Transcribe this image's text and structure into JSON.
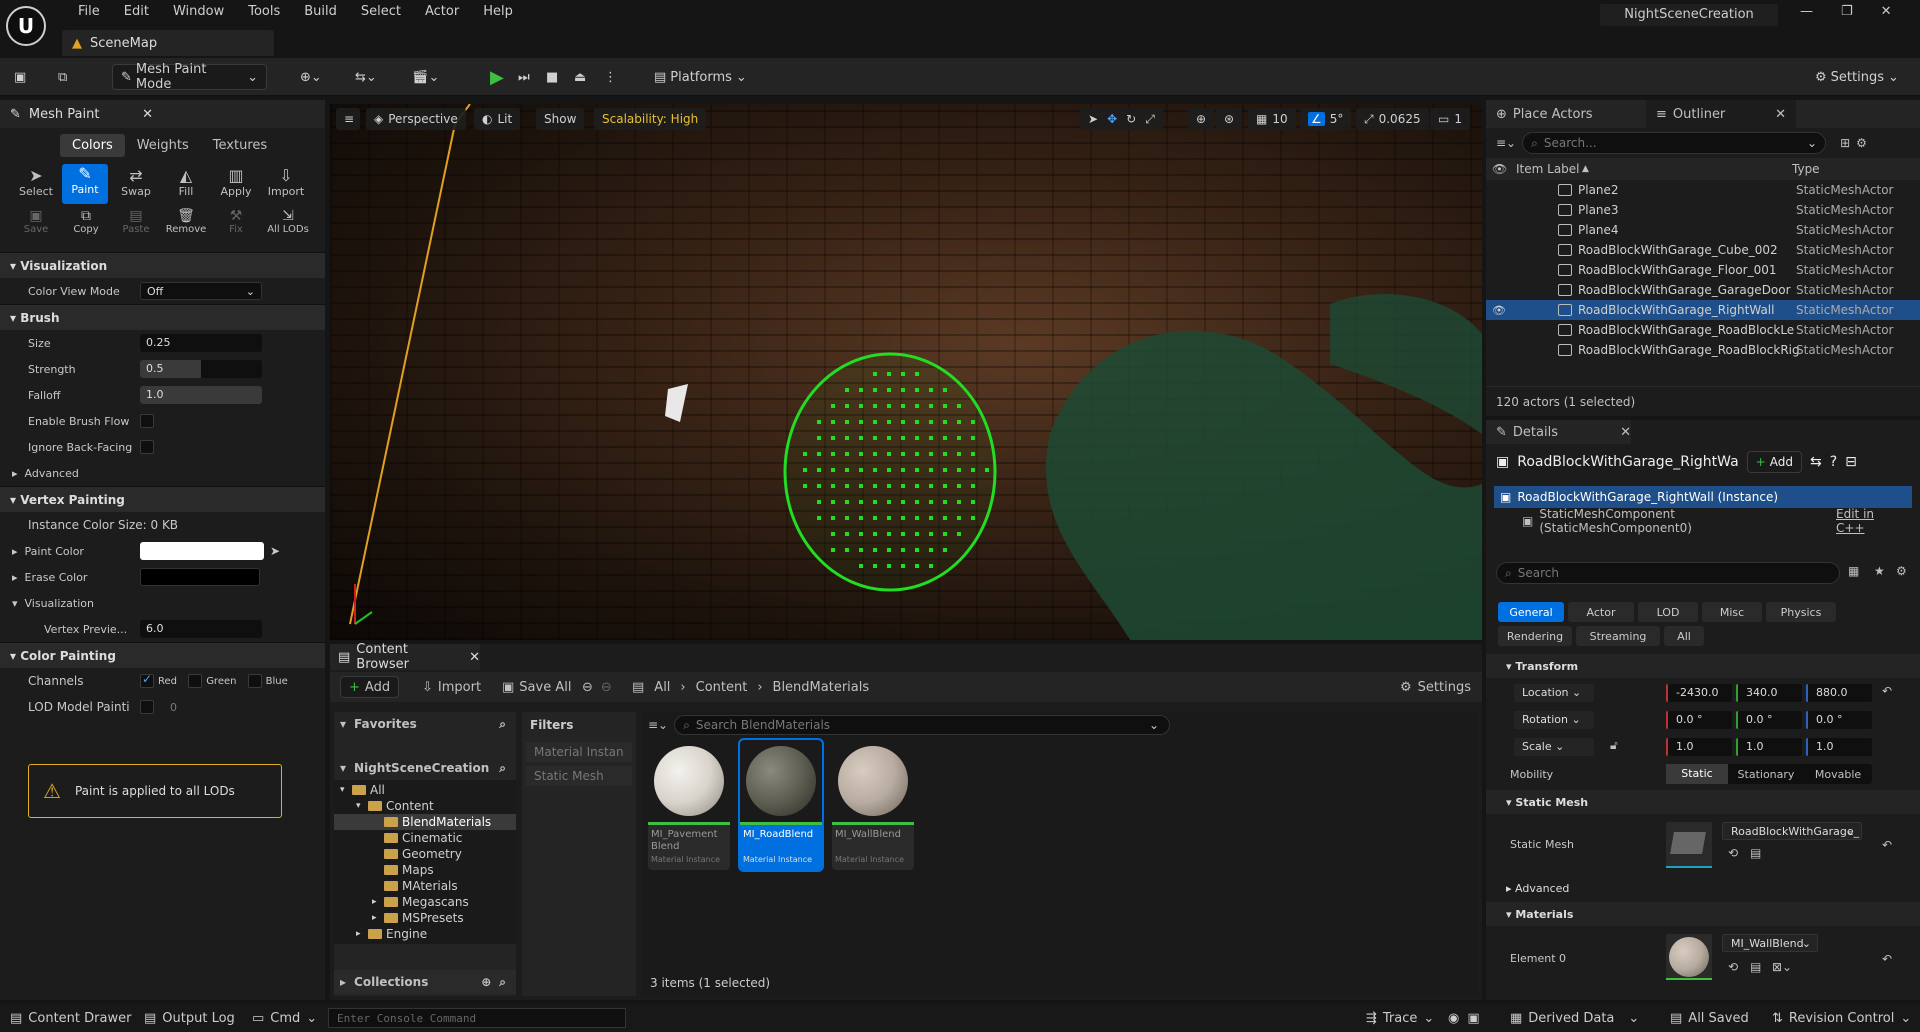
{
  "app": {
    "project_name": "NightSceneCreation",
    "map_tab": "SceneMap",
    "logo_glyph": "U"
  },
  "menu": [
    "File",
    "Edit",
    "Window",
    "Tools",
    "Build",
    "Select",
    "Actor",
    "Help"
  ],
  "toolbar": {
    "mode": "Mesh Paint Mode",
    "platforms": "Platforms",
    "settings": "Settings"
  },
  "mesh_paint": {
    "tab_title": "Mesh Paint",
    "subtabs": [
      "Colors",
      "Weights",
      "Textures"
    ],
    "tools_row1": [
      "Select",
      "Paint",
      "Swap",
      "Fill",
      "Apply",
      "Import"
    ],
    "tools_row2": [
      "Save",
      "Copy",
      "Paste",
      "Remove",
      "Fix",
      "All LODs"
    ],
    "visualization": {
      "header": "Visualization",
      "color_view_mode_label": "Color View Mode",
      "color_view_mode_value": "Off"
    },
    "brush": {
      "header": "Brush",
      "size_label": "Size",
      "size_value": "0.25",
      "strength_label": "Strength",
      "strength_value": "0.5",
      "strength_fill": 0.5,
      "falloff_label": "Falloff",
      "falloff_value": "1.0",
      "enable_brush_flow": "Enable Brush Flow",
      "ignore_back_facing": "Ignore Back-Facing"
    },
    "advanced": "Advanced",
    "vertex_painting": {
      "header": "Vertex Painting",
      "instance_color_size": "Instance Color Size: 0 KB",
      "paint_color_label": "Paint Color",
      "paint_color": "#ffffff",
      "erase_color_label": "Erase Color",
      "erase_color": "#000000",
      "visualization_label": "Visualization",
      "vertex_preview_label": "Vertex Previe...",
      "vertex_preview_value": "6.0"
    },
    "color_painting": {
      "header": "Color Painting",
      "channels_label": "Channels",
      "red": "Red",
      "green": "Green",
      "blue": "Blue",
      "lod_label": "LOD Model Painti",
      "lod_value": "0"
    },
    "warning": "Paint is applied to all LODs"
  },
  "viewport": {
    "menu_icon": "hamburger-icon",
    "perspective": "Perspective",
    "lit": "Lit",
    "show": "Show",
    "scalability": "Scalability: High",
    "grid_value": "10",
    "angle_value": "5°",
    "scale_value": "0.0625",
    "camera_speed": "1"
  },
  "content_browser": {
    "tab_title": "Content Browser",
    "add": "Add",
    "import": "Import",
    "save_all": "Save All",
    "path": [
      "All",
      "Content",
      "BlendMaterials"
    ],
    "settings": "Settings",
    "favorites": "Favorites",
    "project": "NightSceneCreation",
    "tree": [
      {
        "label": "All",
        "depth": 0
      },
      {
        "label": "Content",
        "depth": 1
      },
      {
        "label": "BlendMaterials",
        "depth": 2,
        "selected": true
      },
      {
        "label": "Cinematic",
        "depth": 2
      },
      {
        "label": "Geometry",
        "depth": 2
      },
      {
        "label": "Maps",
        "depth": 2
      },
      {
        "label": "MAterials",
        "depth": 2
      },
      {
        "label": "Megascans",
        "depth": 2
      },
      {
        "label": "MSPresets",
        "depth": 2
      },
      {
        "label": "Engine",
        "depth": 1
      }
    ],
    "collections": "Collections",
    "filters_header": "Filters",
    "filters": [
      "Material Instan",
      "Static Mesh"
    ],
    "search_placeholder": "Search BlendMaterials",
    "assets": [
      {
        "name": "MI_Pavement Blend",
        "type": "Material Instance",
        "ball_color": "#d8d4cc"
      },
      {
        "name": "MI_RoadBlend",
        "type": "Material Instance",
        "ball_color": "#5e5e52",
        "selected": true
      },
      {
        "name": "MI_WallBlend",
        "type": "Material Instance",
        "ball_color": "#b8aca0"
      }
    ],
    "status": "3 items (1 selected)"
  },
  "outliner": {
    "tab_place_actors": "Place Actors",
    "tab_outliner": "Outliner",
    "search_placeholder": "Search...",
    "col_label": "Item Label",
    "col_type": "Type",
    "rows": [
      {
        "label": "Plane2",
        "type": "StaticMeshActor"
      },
      {
        "label": "Plane3",
        "type": "StaticMeshActor"
      },
      {
        "label": "Plane4",
        "type": "StaticMeshActor"
      },
      {
        "label": "RoadBlockWithGarage_Cube_002",
        "type": "StaticMeshActor"
      },
      {
        "label": "RoadBlockWithGarage_Floor_001",
        "type": "StaticMeshActor"
      },
      {
        "label": "RoadBlockWithGarage_GarageDoor",
        "type": "StaticMeshActor"
      },
      {
        "label": "RoadBlockWithGarage_RightWall",
        "type": "StaticMeshActor",
        "selected": true
      },
      {
        "label": "RoadBlockWithGarage_RoadBlockLe",
        "type": "StaticMeshActor"
      },
      {
        "label": "RoadBlockWithGarage_RoadBlockRig",
        "type": "StaticMeshActor"
      }
    ],
    "count": "120 actors (1 selected)"
  },
  "details": {
    "tab_title": "Details",
    "actor_name": "RoadBlockWithGarage_RightWa",
    "add": "Add",
    "instance": "RoadBlockWithGarage_RightWall (Instance)",
    "component": "StaticMeshComponent (StaticMeshComponent0)",
    "edit_cpp": "Edit in C++",
    "search_placeholder": "Search",
    "tabs_row1": [
      "General",
      "Actor",
      "LOD",
      "Misc",
      "Physics"
    ],
    "tabs_row2": [
      "Rendering",
      "Streaming",
      "All"
    ],
    "transform": {
      "header": "Transform",
      "location_label": "Location",
      "location": [
        "-2430.0",
        "340.0",
        "880.0"
      ],
      "rotation_label": "Rotation",
      "rotation": [
        "0.0 °",
        "0.0 °",
        "0.0 °"
      ],
      "scale_label": "Scale",
      "scale": [
        "1.0",
        "1.0",
        "1.0"
      ],
      "mobility_label": "Mobility",
      "mobility": [
        "Static",
        "Stationary",
        "Movable"
      ]
    },
    "static_mesh": {
      "header": "Static Mesh",
      "label": "Static Mesh",
      "value": "RoadBlockWithGarage_"
    },
    "advanced": "Advanced",
    "materials": {
      "header": "Materials",
      "element_label": "Element 0",
      "value": "MI_WallBlend"
    }
  },
  "statusbar": {
    "content_drawer": "Content Drawer",
    "output_log": "Output Log",
    "cmd": "Cmd",
    "console_placeholder": "Enter Console Command",
    "trace": "Trace",
    "derived_data": "Derived Data",
    "all_saved": "All Saved",
    "revision_control": "Revision Control"
  },
  "colors": {
    "accent_blue": "#0070e0",
    "selected_row": "#1f4f8a",
    "brush_green": "#22dd22",
    "warning_yellow": "#e0b020"
  }
}
